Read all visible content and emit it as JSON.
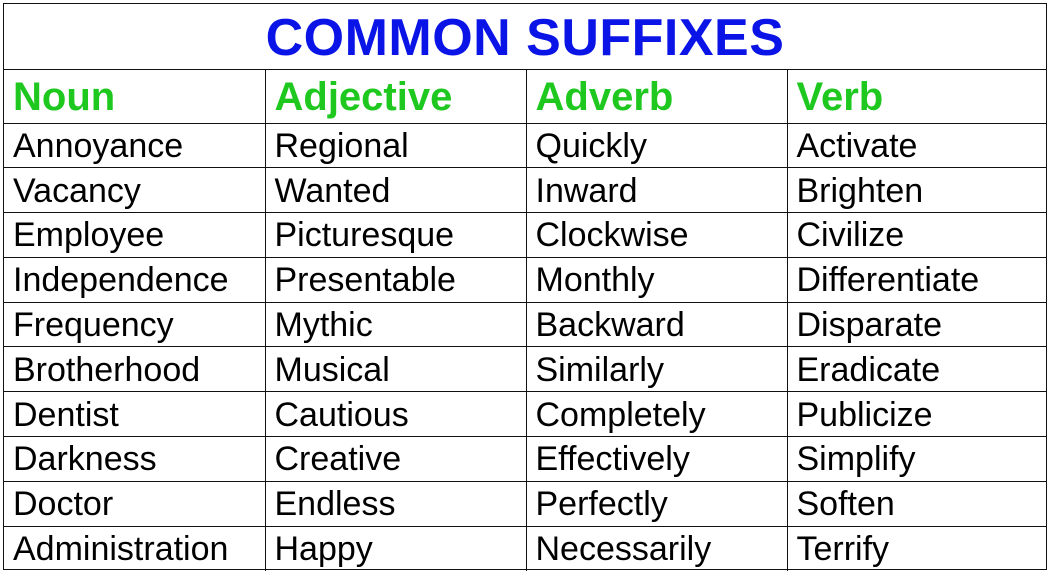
{
  "title": "COMMON SUFFIXES",
  "colors": {
    "title": "#0a14e6",
    "header": "#1ec81e",
    "text": "#000000",
    "border": "#111111"
  },
  "columns": [
    "Noun",
    "Adjective",
    "Adverb",
    "Verb"
  ],
  "rows": [
    [
      "Annoyance",
      "Regional",
      "Quickly",
      "Activate"
    ],
    [
      "Vacancy",
      "Wanted",
      "Inward",
      "Brighten"
    ],
    [
      "Employee",
      "Picturesque",
      "Clockwise",
      "Civilize"
    ],
    [
      "Independence",
      "Presentable",
      "Monthly",
      "Differentiate"
    ],
    [
      "Frequency",
      "Mythic",
      "Backward",
      "Disparate"
    ],
    [
      "Brotherhood",
      "Musical",
      "Similarly",
      "Eradicate"
    ],
    [
      "Dentist",
      "Cautious",
      "Completely",
      "Publicize"
    ],
    [
      "Darkness",
      "Creative",
      "Effectively",
      "Simplify"
    ],
    [
      "Doctor",
      "Endless",
      "Perfectly",
      "Soften"
    ],
    [
      "Administration",
      "Happy",
      "Necessarily",
      "Terrify"
    ]
  ]
}
